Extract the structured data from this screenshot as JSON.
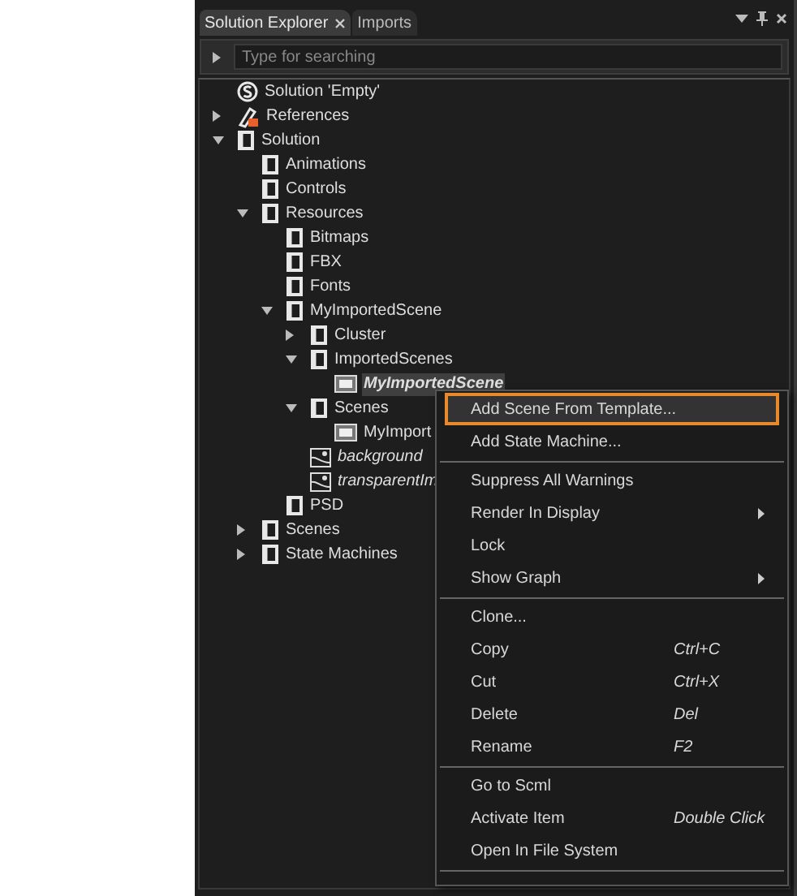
{
  "tabs": [
    {
      "label": "Solution Explorer",
      "selected": true,
      "closable": true
    },
    {
      "label": "Imports",
      "selected": false,
      "closable": false
    }
  ],
  "search": {
    "placeholder": "Type for searching"
  },
  "tree": [
    {
      "label": "Solution 'Empty'",
      "kind": "solution",
      "selected": false
    },
    {
      "label": "References",
      "kind": "references",
      "selected": false,
      "expanded": false
    },
    {
      "label": "Solution",
      "kind": "folder",
      "selected": false,
      "expanded": true,
      "children": [
        {
          "label": "Animations",
          "kind": "folder",
          "selected": false
        },
        {
          "label": "Controls",
          "kind": "folder",
          "selected": false
        },
        {
          "label": "Resources",
          "kind": "folder",
          "selected": false,
          "expanded": true,
          "children": [
            {
              "label": "Bitmaps",
              "kind": "folder",
              "selected": false
            },
            {
              "label": "FBX",
              "kind": "folder",
              "selected": false
            },
            {
              "label": "Fonts",
              "kind": "folder",
              "selected": false
            },
            {
              "label": "MyImportedScene",
              "kind": "folder",
              "selected": false,
              "expanded": true,
              "children": [
                {
                  "label": "Cluster",
                  "kind": "folder",
                  "selected": false,
                  "expanded": false
                },
                {
                  "label": "ImportedScenes",
                  "kind": "folder",
                  "selected": false,
                  "expanded": true,
                  "children": [
                    {
                      "label": "MyImportedScene",
                      "kind": "scene",
                      "selected": true
                    }
                  ]
                },
                {
                  "label": "Scenes",
                  "kind": "folder",
                  "selected": false,
                  "expanded": true,
                  "children": [
                    {
                      "label": "MyImport",
                      "kind": "scene",
                      "selected": false
                    }
                  ]
                },
                {
                  "label": "background",
                  "kind": "image",
                  "selected": false
                },
                {
                  "label": "transparentIm",
                  "kind": "image",
                  "selected": false
                }
              ]
            },
            {
              "label": "PSD",
              "kind": "folder",
              "selected": false
            }
          ]
        },
        {
          "label": "Scenes",
          "kind": "folder",
          "selected": false,
          "expanded": false
        },
        {
          "label": "State Machines",
          "kind": "folder",
          "selected": false,
          "expanded": false
        }
      ]
    }
  ],
  "context_menu": {
    "groups": [
      {
        "items": [
          {
            "label": "Add Scene From Template...",
            "selected": true
          },
          {
            "label": "Add State Machine...",
            "selected": false
          }
        ]
      },
      {
        "items": [
          {
            "label": "Suppress All Warnings",
            "selected": false
          },
          {
            "label": "Render In Display",
            "selected": false,
            "submenu": true
          },
          {
            "label": "Lock",
            "selected": false
          },
          {
            "label": "Show Graph",
            "selected": false,
            "submenu": true
          }
        ]
      },
      {
        "items": [
          {
            "label": "Clone...",
            "selected": false
          },
          {
            "label": "Copy",
            "shortcut": "Ctrl+C",
            "selected": false
          },
          {
            "label": "Cut",
            "shortcut": "Ctrl+X",
            "selected": false
          },
          {
            "label": "Delete",
            "shortcut": "Del",
            "selected": false
          },
          {
            "label": "Rename",
            "shortcut": "F2",
            "selected": false
          }
        ]
      },
      {
        "items": [
          {
            "label": "Go to Scml",
            "selected": false
          },
          {
            "label": "Activate Item",
            "shortcut": "Double Click",
            "selected": false
          },
          {
            "label": "Open In File System",
            "selected": false
          }
        ]
      }
    ]
  }
}
